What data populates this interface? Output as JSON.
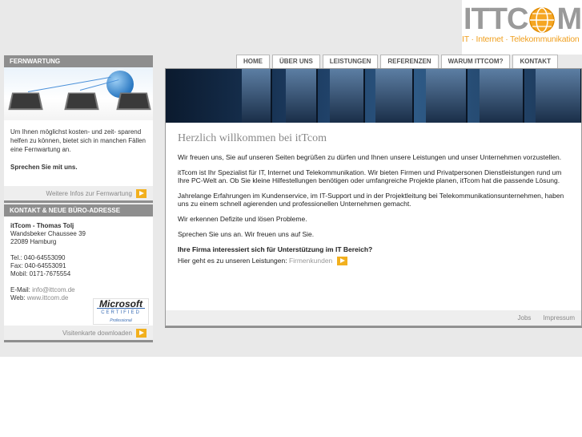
{
  "logo": {
    "wordmark_left": "ITTC",
    "wordmark_right": "M",
    "tagline": "IT · Internet · Telekommunikation",
    "colors": {
      "gray": "#9a9a9a",
      "orange": "#f0a020"
    }
  },
  "nav": {
    "tabs": [
      "HOME",
      "ÜBER UNS",
      "LEISTUNGEN",
      "REFERENZEN",
      "WARUM ITTCOM?",
      "KONTAKT"
    ]
  },
  "sidebar": {
    "fernwartung": {
      "title": "FERNWARTUNG",
      "text": "Um Ihnen möglichst kosten- und zeit- sparend helfen zu können, bietet sich in manchen Fällen eine Fernwartung an.",
      "cta": "Sprechen Sie mit uns.",
      "link": "Weitere Infos zur Fernwartung",
      "link_icon": "arrow-right-icon"
    },
    "kontakt": {
      "title": "KONTAKT & NEUE BÜRO-ADRESSE",
      "company": "itTcom - Thomas Tolj",
      "street": "Wandsbeker Chaussee 39",
      "city": "22089 Hamburg",
      "tel": "Tel.: 040-64553090",
      "fax": "Fax: 040-64553091",
      "mobil": "Mobil: 0171-7675554",
      "email_label": "E-Mail:",
      "email": "info@ittcom.de",
      "web_label": "Web:",
      "web": "www.ittcom.de",
      "link": "Visitenkarte downloaden",
      "badge": {
        "brand": "Microsoft",
        "line1": "CERTIFIED",
        "line2": "Professional"
      }
    }
  },
  "main": {
    "heading": "Herzlich willkommen bei itTcom",
    "p1": "Wir freuen uns, Sie auf unseren Seiten begrüßen zu dürfen und Ihnen unsere Leistungen und unser Unternehmen vorzustellen.",
    "p2": "itTcom ist Ihr Spezialist für IT, Internet und Telekommunikation. Wir bieten Firmen und Privatpersonen Dienstleistungen rund um Ihre PC-Welt an. Ob Sie kleine Hilfestellungen benötigen oder umfangreiche Projekte planen, itTcom hat die passende Lösung.",
    "p3": "Jahrelange Erfahrungen im Kundenservice, im IT-Support und in der Projektleitung bei Telekommunikationsunternehmen, haben uns zu einem schnell agierenden und professionellen Unternehmen gemacht.",
    "p4": "Wir erkennen Defizite und lösen Probleme.",
    "p5": "Sprechen Sie uns an. Wir freuen uns auf Sie.",
    "question": "Ihre Firma interessiert sich für Unterstützung im IT Bereich?",
    "lead": "Hier geht es zu unseren Leistungen:",
    "lead_link": "Firmenkunden",
    "footer_links": [
      "Jobs",
      "Impressum"
    ]
  }
}
